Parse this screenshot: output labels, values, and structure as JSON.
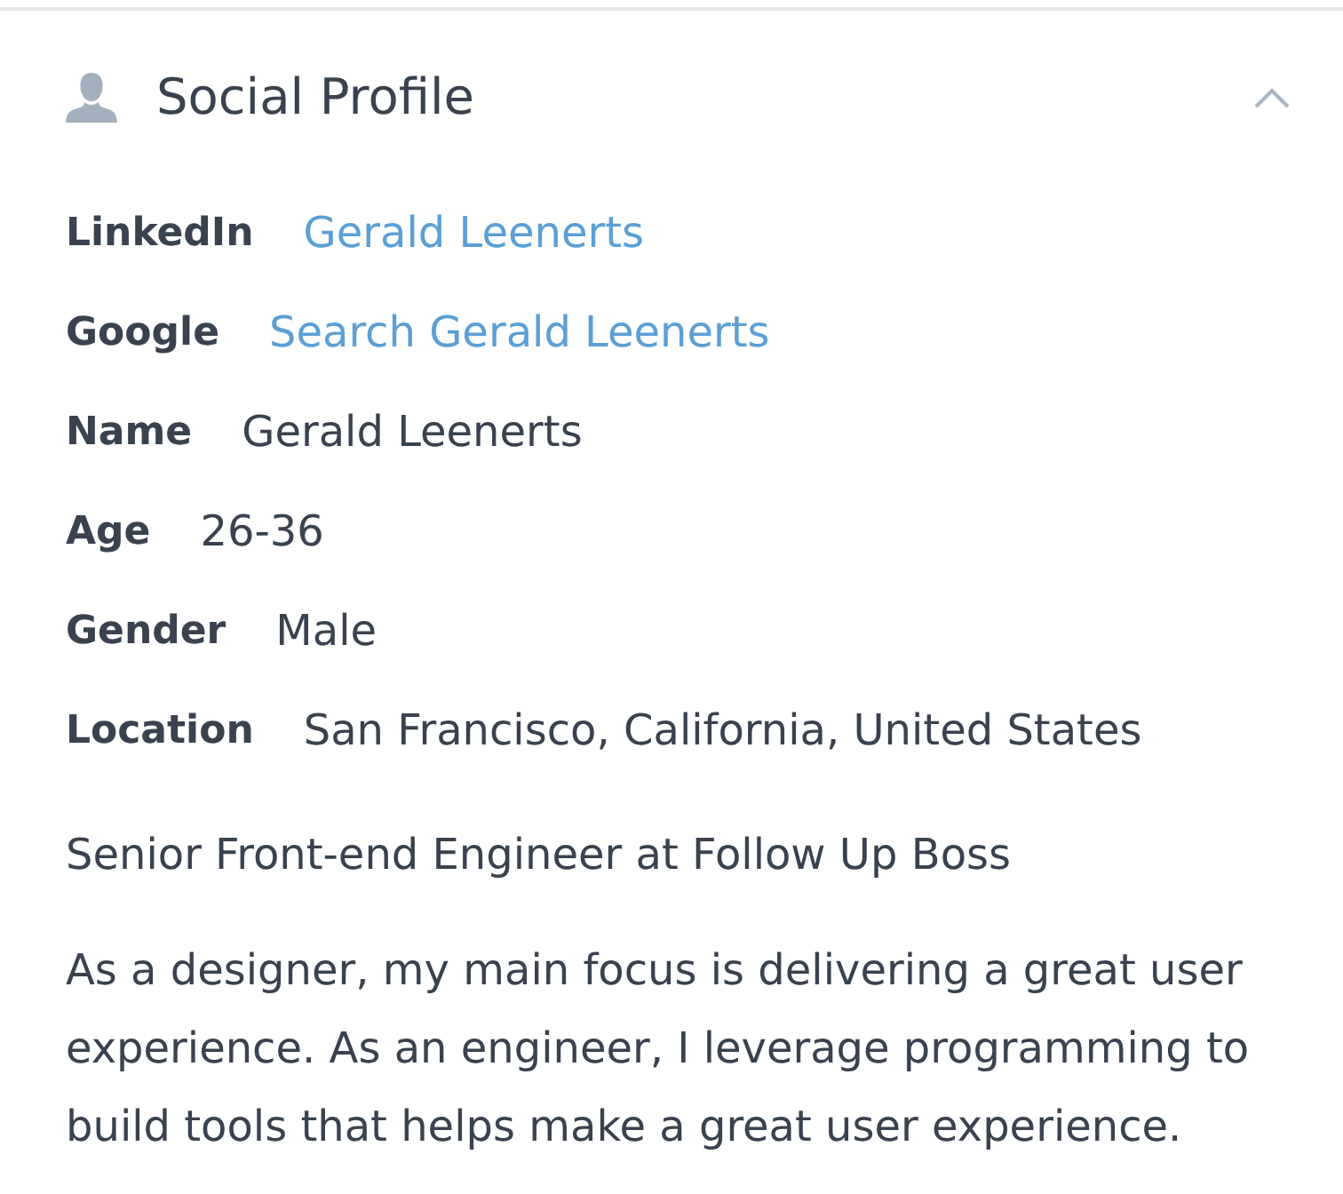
{
  "section": {
    "title": "Social Profile",
    "expanded": true
  },
  "fields": [
    {
      "label": "LinkedIn",
      "value": "Gerald Leenerts",
      "kind": "link"
    },
    {
      "label": "Google",
      "value": "Search Gerald Leenerts",
      "kind": "link"
    },
    {
      "label": "Name",
      "value": "Gerald Leenerts",
      "kind": "text"
    },
    {
      "label": "Age",
      "value": "26-36",
      "kind": "text"
    },
    {
      "label": "Gender",
      "value": "Male",
      "kind": "text"
    },
    {
      "label": "Location",
      "value": "San Francisco, California, United States",
      "kind": "text"
    }
  ],
  "headline": "Senior Front-end Engineer at Follow Up Boss",
  "bio": "As a designer, my main focus is delivering a great user experience. As an engineer, I leverage programming to build tools that helps make a great user experience."
}
